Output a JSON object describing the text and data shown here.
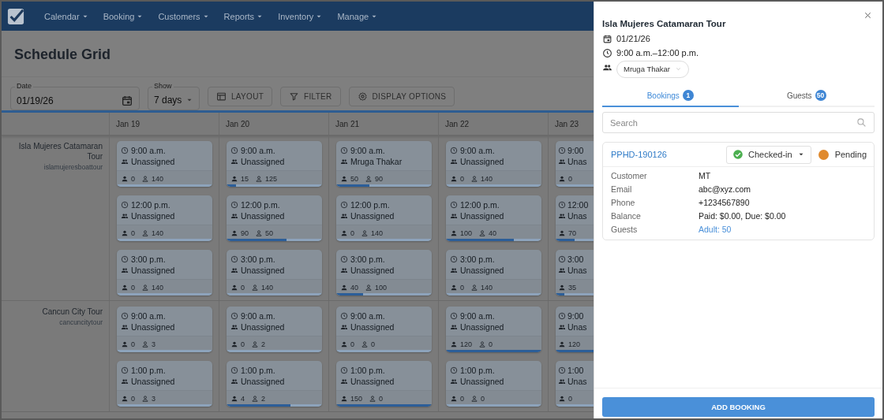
{
  "nav": {
    "items": [
      {
        "label": "Calendar"
      },
      {
        "label": "Booking"
      },
      {
        "label": "Customers"
      },
      {
        "label": "Reports"
      },
      {
        "label": "Inventory"
      },
      {
        "label": "Manage"
      }
    ]
  },
  "page": {
    "title": "Schedule Grid"
  },
  "toolbar": {
    "date": {
      "label": "Date",
      "value": "01/19/26"
    },
    "show": {
      "label": "Show",
      "value": "7 days"
    },
    "buttons": [
      {
        "label": "LAYOUT",
        "kind": "layout"
      },
      {
        "label": "FILTER",
        "kind": "filter"
      },
      {
        "label": "DISPLAY OPTIONS",
        "kind": "settings"
      }
    ]
  },
  "grid": {
    "columns": [
      "Jan 19",
      "Jan 20",
      "Jan 21",
      "Jan 22",
      "Jan 23"
    ],
    "tours": [
      {
        "name": "Isla Mujeres Catamaran Tour",
        "code": "islamujeresboattour",
        "rows": [
          [
            {
              "time": "9:00 a.m.",
              "assignee": "Unassigned",
              "booked": "0",
              "available": "140"
            },
            {
              "time": "9:00 a.m.",
              "assignee": "Unassigned",
              "booked": "15",
              "available": "125",
              "level": 0.1
            },
            {
              "time": "9:00 a.m.",
              "assignee": "Mruga Thakar",
              "booked": "50",
              "available": "90",
              "level": 0.35
            },
            {
              "time": "9:00 a.m.",
              "assignee": "Unassigned",
              "booked": "0",
              "available": "140"
            },
            {
              "time": "9:00",
              "assignee": "Unas",
              "booked": "0"
            }
          ],
          [
            {
              "time": "12:00 p.m.",
              "assignee": "Unassigned",
              "booked": "0",
              "available": "140"
            },
            {
              "time": "12:00 p.m.",
              "assignee": "Unassigned",
              "booked": "90",
              "available": "50",
              "level": 0.63
            },
            {
              "time": "12:00 p.m.",
              "assignee": "Unassigned",
              "booked": "0",
              "available": "140"
            },
            {
              "time": "12:00 p.m.",
              "assignee": "Unassigned",
              "booked": "100",
              "available": "40",
              "level": 0.71
            },
            {
              "time": "12:00",
              "assignee": "Unas",
              "booked": "70",
              "level": 0.5
            }
          ],
          [
            {
              "time": "3:00 p.m.",
              "assignee": "Unassigned",
              "booked": "0",
              "available": "140"
            },
            {
              "time": "3:00 p.m.",
              "assignee": "Unassigned",
              "booked": "0",
              "available": "140"
            },
            {
              "time": "3:00 p.m.",
              "assignee": "Unassigned",
              "booked": "40",
              "available": "100",
              "level": 0.28
            },
            {
              "time": "3:00 p.m.",
              "assignee": "Unassigned",
              "booked": "0",
              "available": "140"
            },
            {
              "time": "3:00",
              "assignee": "Unas",
              "booked": "35",
              "level": 0.25
            }
          ]
        ]
      },
      {
        "name": "Cancun City Tour",
        "code": "cancuncitytour",
        "rows": [
          [
            {
              "time": "9:00 a.m.",
              "assignee": "Unassigned",
              "booked": "0",
              "available": "3"
            },
            {
              "time": "9:00 a.m.",
              "assignee": "Unassigned",
              "booked": "0",
              "available": "2"
            },
            {
              "time": "9:00 a.m.",
              "assignee": "Unassigned",
              "booked": "0",
              "available": "0"
            },
            {
              "time": "9:00 a.m.",
              "assignee": "Unassigned",
              "booked": "120",
              "available": "0",
              "level": 1
            },
            {
              "time": "9:00",
              "assignee": "Unas",
              "booked": "120",
              "level": 1
            }
          ],
          [
            {
              "time": "1:00 p.m.",
              "assignee": "Unassigned",
              "booked": "0",
              "available": "3"
            },
            {
              "time": "1:00 p.m.",
              "assignee": "Unassigned",
              "booked": "4",
              "available": "2",
              "level": 0.67
            },
            {
              "time": "1:00 p.m.",
              "assignee": "Unassigned",
              "booked": "150",
              "available": "0",
              "level": 1
            },
            {
              "time": "1:00 p.m.",
              "assignee": "Unassigned",
              "booked": "0",
              "available": "0"
            },
            {
              "time": "1:00",
              "assignee": "Unas",
              "booked": "0"
            }
          ]
        ]
      }
    ]
  },
  "drawer": {
    "title": "Isla Mujeres Catamaran Tour",
    "date": "01/21/26",
    "time": "9:00 a.m.–12:00 p.m.",
    "guide": "Mruga Thakar",
    "tabs": [
      {
        "label": "Bookings",
        "count": "1",
        "selected": true
      },
      {
        "label": "Guests",
        "count": "50",
        "selected": false
      }
    ],
    "search": {
      "placeholder": "Search"
    },
    "bookings": [
      {
        "id": "PPHD-190126",
        "status": "Checked-in",
        "checked_in": true,
        "payment": "Pending",
        "color": "#e08a2e",
        "details": [
          {
            "label": "Customer",
            "value": "MT",
            "kind": "text"
          },
          {
            "label": "Email",
            "value": "abc@xyz.com",
            "kind": "text"
          },
          {
            "label": "Phone",
            "value": "+1234567890",
            "kind": "text"
          },
          {
            "label": "Balance",
            "value": "Paid: $0.00, Due: $0.00",
            "kind": "text"
          },
          {
            "label": "Guests",
            "value": "Adult: 50",
            "kind": "link"
          }
        ]
      }
    ],
    "action": {
      "label": "ADD BOOKING"
    }
  }
}
